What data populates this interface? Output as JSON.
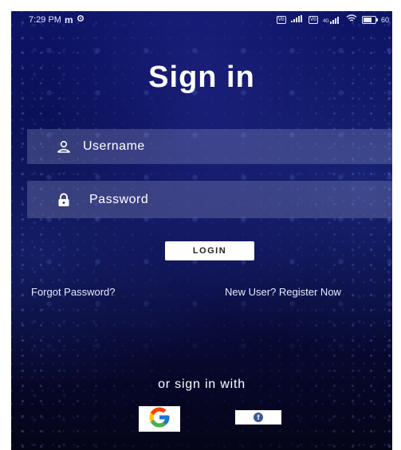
{
  "status_bar": {
    "time": "7:29 PM",
    "carrier_icon": "m",
    "settings_icon": "gear-icon",
    "sim1": "Vo",
    "sim2": "Vo",
    "network": "4G",
    "battery": "60"
  },
  "screen": {
    "title": "Sign in"
  },
  "username_field": {
    "placeholder": "Username",
    "icon": "person-icon"
  },
  "password_field": {
    "placeholder": "Password",
    "icon": "lock-icon"
  },
  "login_button": {
    "label": "LOGIN"
  },
  "links": {
    "forgot_password": "Forgot Password?",
    "register": "New User? Register Now"
  },
  "social": {
    "prompt": "or sign in with",
    "google_icon": "google-icon",
    "facebook_icon": "facebook-icon",
    "facebook_letter": "f"
  },
  "colors": {
    "background": "#0b1158",
    "field_bg": "rgba(160,170,210,0.28)",
    "text": "#ffffff",
    "facebook": "#3b5998"
  }
}
